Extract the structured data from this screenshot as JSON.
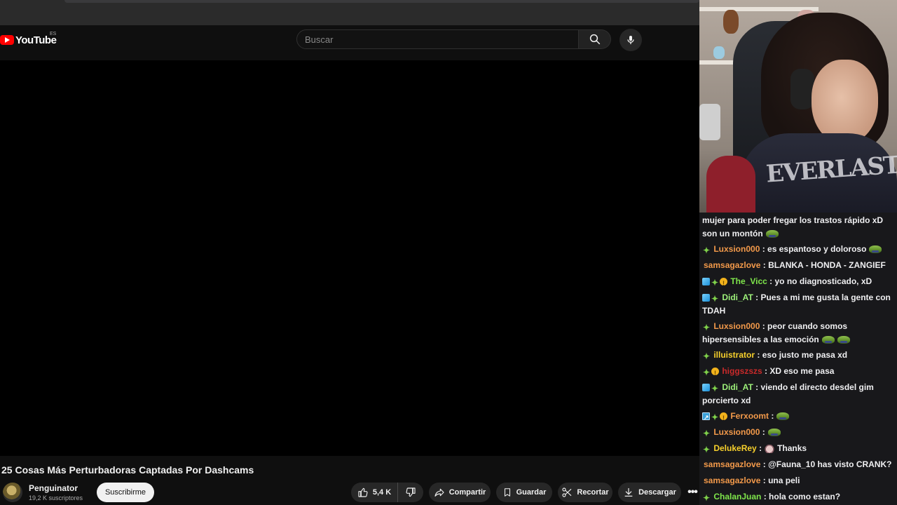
{
  "youtube": {
    "logo_text": "YouTube",
    "region": "ES",
    "search_placeholder": "Buscar",
    "video_title": "25 Cosas Más Perturbadoras Captadas Por Dashcams",
    "channel": {
      "name": "Penguinator",
      "subscribers": "19,2 K suscriptores",
      "subscribe_label": "Suscribirme"
    },
    "actions": {
      "likes": "5,4 K",
      "share": "Compartir",
      "save": "Guardar",
      "clip": "Recortar",
      "download": "Descargar",
      "more": "•••"
    }
  },
  "webcam": {
    "shirt_print": "EVERLAST"
  },
  "chat": {
    "messages": [
      {
        "user": "",
        "text": "mujer para poder fregar los trastos rápido xD son un montón",
        "emotes": 1
      },
      {
        "user": "Luxsion000",
        "text": ": es espantoso y doloroso",
        "emotes": 1
      },
      {
        "user": "samsagazlove",
        "text": ": BLANKA - HONDA - ZANGIEF"
      },
      {
        "user": "The_Vicc",
        "text": ": yo no diagnosticado, xD"
      },
      {
        "user": "Didi_AT",
        "text": ": Pues a mi me gusta la gente con TDAH"
      },
      {
        "user": "Luxsion000",
        "text": ": peor cuando somos hipersensibles a las emoción",
        "emotes": 2
      },
      {
        "user": "illuistrator",
        "text": ": eso justo me pasa xd"
      },
      {
        "user": "higgszszs",
        "text": ": XD eso me pasa"
      },
      {
        "user": "Didi_AT",
        "text": ": viendo el directo desdel gim porcierto xd"
      },
      {
        "user": "Ferxoomt",
        "text": ":",
        "emotes": 1
      },
      {
        "user": "Luxsion000",
        "text": ":",
        "emotes": 1
      },
      {
        "user": "DelukeRey",
        "text": "Thanks"
      },
      {
        "user": "samsagazlove",
        "text": ": @Fauna_10 has visto CRANK?"
      },
      {
        "user": "samsagazlove",
        "text": ": una peli"
      },
      {
        "user": "ChalanJuan",
        "text": ": hola como estan?"
      }
    ]
  },
  "colors": {
    "youtube_red": "#ff0000",
    "yt_bg": "#0f0f0f",
    "chat_bg": "#18181b",
    "username_orange": "#f2994a",
    "username_green": "#7fe64b",
    "username_yellow": "#f7d02c",
    "username_red": "#c92a2a"
  }
}
